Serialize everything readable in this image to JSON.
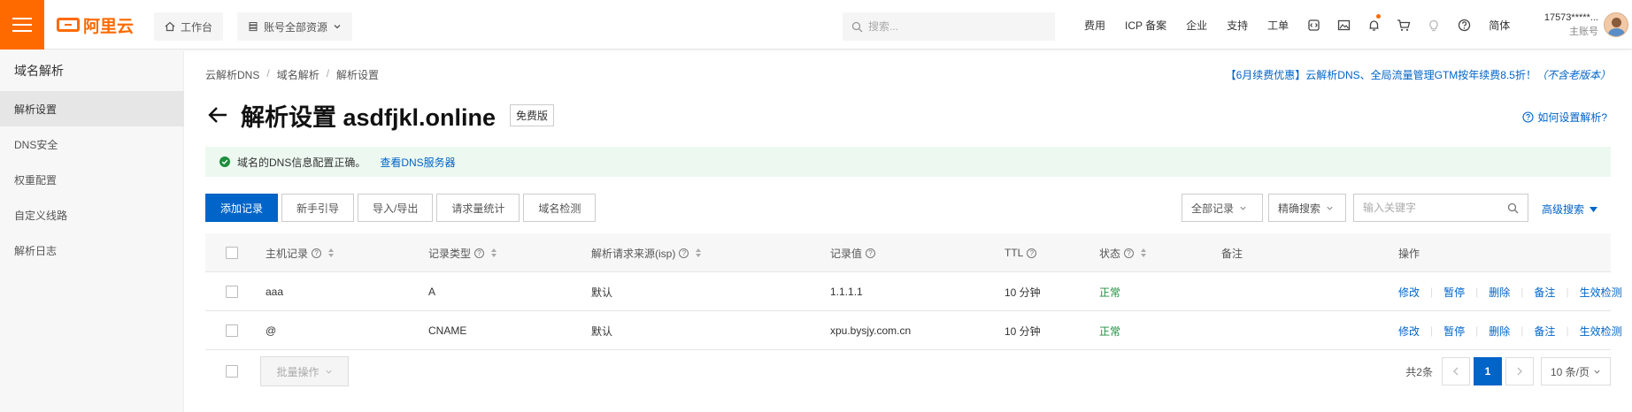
{
  "header": {
    "logo_text": "阿里云",
    "workbench_label": "工作台",
    "resources_label": "账号全部资源",
    "search_placeholder": "搜索...",
    "nav_links": [
      "费用",
      "ICP 备案",
      "企业",
      "支持",
      "工单"
    ],
    "lang_label": "简体",
    "user_id": "17573*****...",
    "user_role": "主账号"
  },
  "sidebar": {
    "title": "域名解析",
    "items": [
      {
        "label": "解析设置"
      },
      {
        "label": "DNS安全"
      },
      {
        "label": "权重配置"
      },
      {
        "label": "自定义线路"
      },
      {
        "label": "解析日志"
      }
    ]
  },
  "breadcrumb": [
    "云解析DNS",
    "域名解析",
    "解析设置"
  ],
  "promo": {
    "text": "【6月续费优惠】云解析DNS、全局流量管理GTM按年续费8.5折！",
    "suffix": "（不含老版本）"
  },
  "page": {
    "title": "解析设置 asdfjkl.online",
    "badge": "免费版",
    "help_link": "如何设置解析?"
  },
  "notice": {
    "text": "域名的DNS信息配置正确。",
    "link": "查看DNS服务器"
  },
  "toolbar": {
    "buttons": [
      "添加记录",
      "新手引导",
      "导入/导出",
      "请求量统计",
      "域名检测"
    ],
    "filter_all": "全部记录",
    "filter_mode": "精确搜索",
    "keyword_placeholder": "输入关键字",
    "advanced_search": "高级搜索"
  },
  "table": {
    "columns": [
      "主机记录",
      "记录类型",
      "解析请求来源(isp)",
      "记录值",
      "TTL",
      "状态",
      "备注",
      "操作"
    ],
    "rows": [
      {
        "host": "aaa",
        "type": "A",
        "isp": "默认",
        "value": "1.1.1.1",
        "ttl": "10 分钟",
        "status": "正常",
        "remark": ""
      },
      {
        "host": "@",
        "type": "CNAME",
        "isp": "默认",
        "value": "xpu.bysjy.com.cn",
        "ttl": "10 分钟",
        "status": "正常",
        "remark": ""
      }
    ],
    "actions": [
      "修改",
      "暂停",
      "删除",
      "备注",
      "生效检测"
    ]
  },
  "footer": {
    "batch_label": "批量操作",
    "total": "共2条",
    "current_page": "1",
    "page_size": "10 条/页"
  },
  "colors": {
    "brand": "#ff6a00",
    "primary": "#0064c8",
    "success": "#1e8e3e"
  }
}
